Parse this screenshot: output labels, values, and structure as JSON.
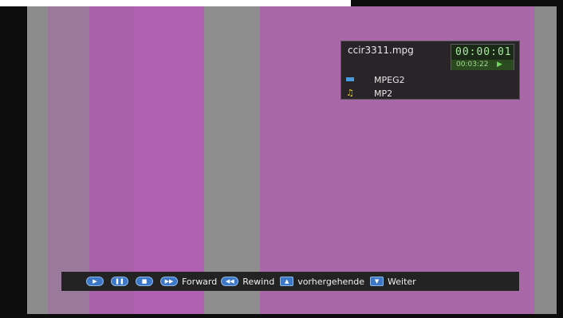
{
  "info_panel": {
    "file_name": "ccir3311.mpg",
    "current_time": "00:00:01",
    "total_time": "00:03:22",
    "play_state_icon": "▶",
    "video_codec": "MPEG2",
    "audio_codec": "MP2",
    "video_icon": "video-stream-icon",
    "audio_icon": "music-note-icon"
  },
  "controls": {
    "play_glyph": "▶",
    "pause_glyph": "❚❚",
    "stop_glyph": "■",
    "forward_glyph": "▶▶",
    "forward_label": "Forward",
    "rewind_glyph": "◀◀",
    "rewind_label": "Rewind",
    "up_glyph": "▲",
    "previous_label": "vorhergehende",
    "down_glyph": "▼",
    "next_label": "Weiter"
  },
  "colors": {
    "video_magenta": "#a868a8",
    "grey_band": "#8c8c8c",
    "button_blue": "#3d78c8",
    "timer_green": "#a8e8a0"
  }
}
